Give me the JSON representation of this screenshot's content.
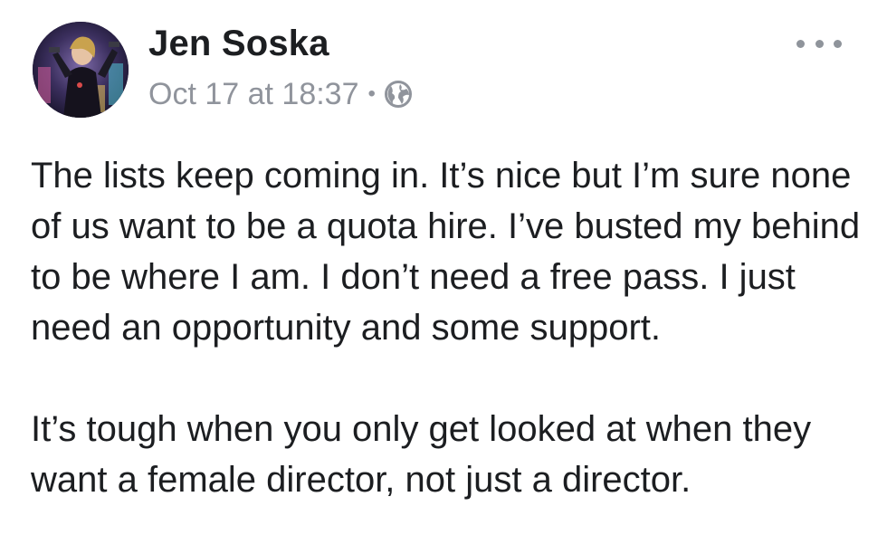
{
  "post": {
    "author": "Jen Soska",
    "timestamp": "Oct 17 at 18:37",
    "separator": "•",
    "privacy_icon": "globe-icon",
    "menu_icon": "more-options-icon",
    "paragraphs": [
      "The lists keep coming in. It’s nice but I’m sure none of us want to be a quota hire. I’ve busted my behind to be where I am. I don’t need a free pass. I just need an opportunity and some support.",
      "It’s tough when you only get looked at when they want a female director, not just a director."
    ]
  },
  "colors": {
    "text": "#1c1e21",
    "meta": "#90949c",
    "background": "#ffffff"
  }
}
